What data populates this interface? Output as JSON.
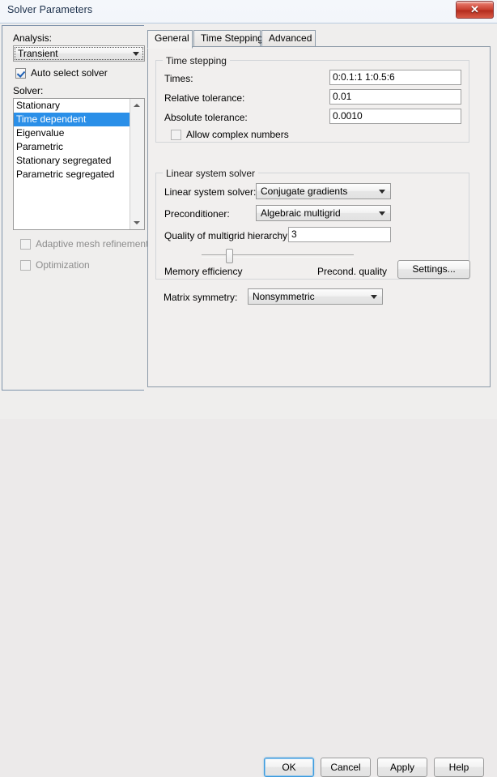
{
  "window": {
    "title": "Solver Parameters",
    "close_label": "✕"
  },
  "left_panel": {
    "analysis_label": "Analysis:",
    "analysis_value": "Transient",
    "auto_select_solver_label": "Auto select solver",
    "auto_select_solver_checked": true,
    "solver_label": "Solver:",
    "solver_items": [
      "Stationary",
      "Time dependent",
      "Eigenvalue",
      "Parametric",
      "Stationary segregated",
      "Parametric segregated"
    ],
    "solver_selected": "Time dependent",
    "adaptive_mesh_label": "Adaptive mesh refinement",
    "optimization_label": "Optimization"
  },
  "tabs": [
    {
      "label": "General",
      "active": true
    },
    {
      "label": "Time Stepping",
      "active": false
    },
    {
      "label": "Advanced",
      "active": false
    }
  ],
  "time_stepping": {
    "group_title": "Time stepping",
    "times_label": "Times:",
    "times_value": "0:0.1:1 1:0.5:6",
    "rel_tol_label": "Relative tolerance:",
    "rel_tol_value": "0.01",
    "abs_tol_label": "Absolute tolerance:",
    "abs_tol_value": "0.0010",
    "allow_complex_label": "Allow complex numbers",
    "allow_complex_checked": false
  },
  "linear_system": {
    "group_title": "Linear system solver",
    "solver_label": "Linear system solver:",
    "solver_value": "Conjugate gradients",
    "precond_label": "Preconditioner:",
    "precond_value": "Algebraic multigrid",
    "quality_label": "Quality of multigrid hierarchy:",
    "quality_value": "3",
    "slider_left_label": "Memory efficiency",
    "slider_right_label": "Precond. quality",
    "slider_percent": 17,
    "settings_label": "Settings..."
  },
  "matrix": {
    "label": "Matrix symmetry:",
    "value": "Nonsymmetric"
  },
  "buttons": {
    "ok": "OK",
    "cancel": "Cancel",
    "apply": "Apply",
    "help": "Help"
  }
}
